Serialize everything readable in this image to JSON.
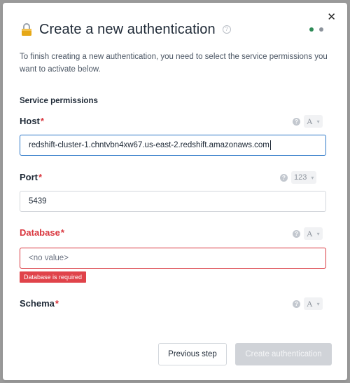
{
  "modal": {
    "title": "Create a new authentication",
    "help_icon": "?",
    "description": "To finish creating a new authentication, you need to select the service permissions you want to activate below.",
    "close_icon": "✕",
    "steps": [
      {
        "state": "active"
      },
      {
        "state": "inactive"
      }
    ],
    "colors": {
      "accent": "#2a76c7",
      "error": "#d9363e",
      "step_active": "#2e8b57"
    }
  },
  "section": {
    "title": "Service permissions"
  },
  "fields": {
    "host": {
      "label": "Host",
      "required": "*",
      "value": "redshift-cluster-1.chntvbn4xw67.us-east-2.redshift.amazonaws.com",
      "type_label": "A",
      "help": "?"
    },
    "port": {
      "label": "Port",
      "required": "*",
      "value": "5439",
      "type_label": "123",
      "help": "?"
    },
    "database": {
      "label": "Database",
      "required": "*",
      "placeholder": "<no value>",
      "type_label": "A",
      "help": "?",
      "error": "Database is required"
    },
    "schema": {
      "label": "Schema",
      "required": "*",
      "type_label": "A",
      "help": "?"
    }
  },
  "footer": {
    "previous_label": "Previous step",
    "create_label": "Create authentication"
  }
}
